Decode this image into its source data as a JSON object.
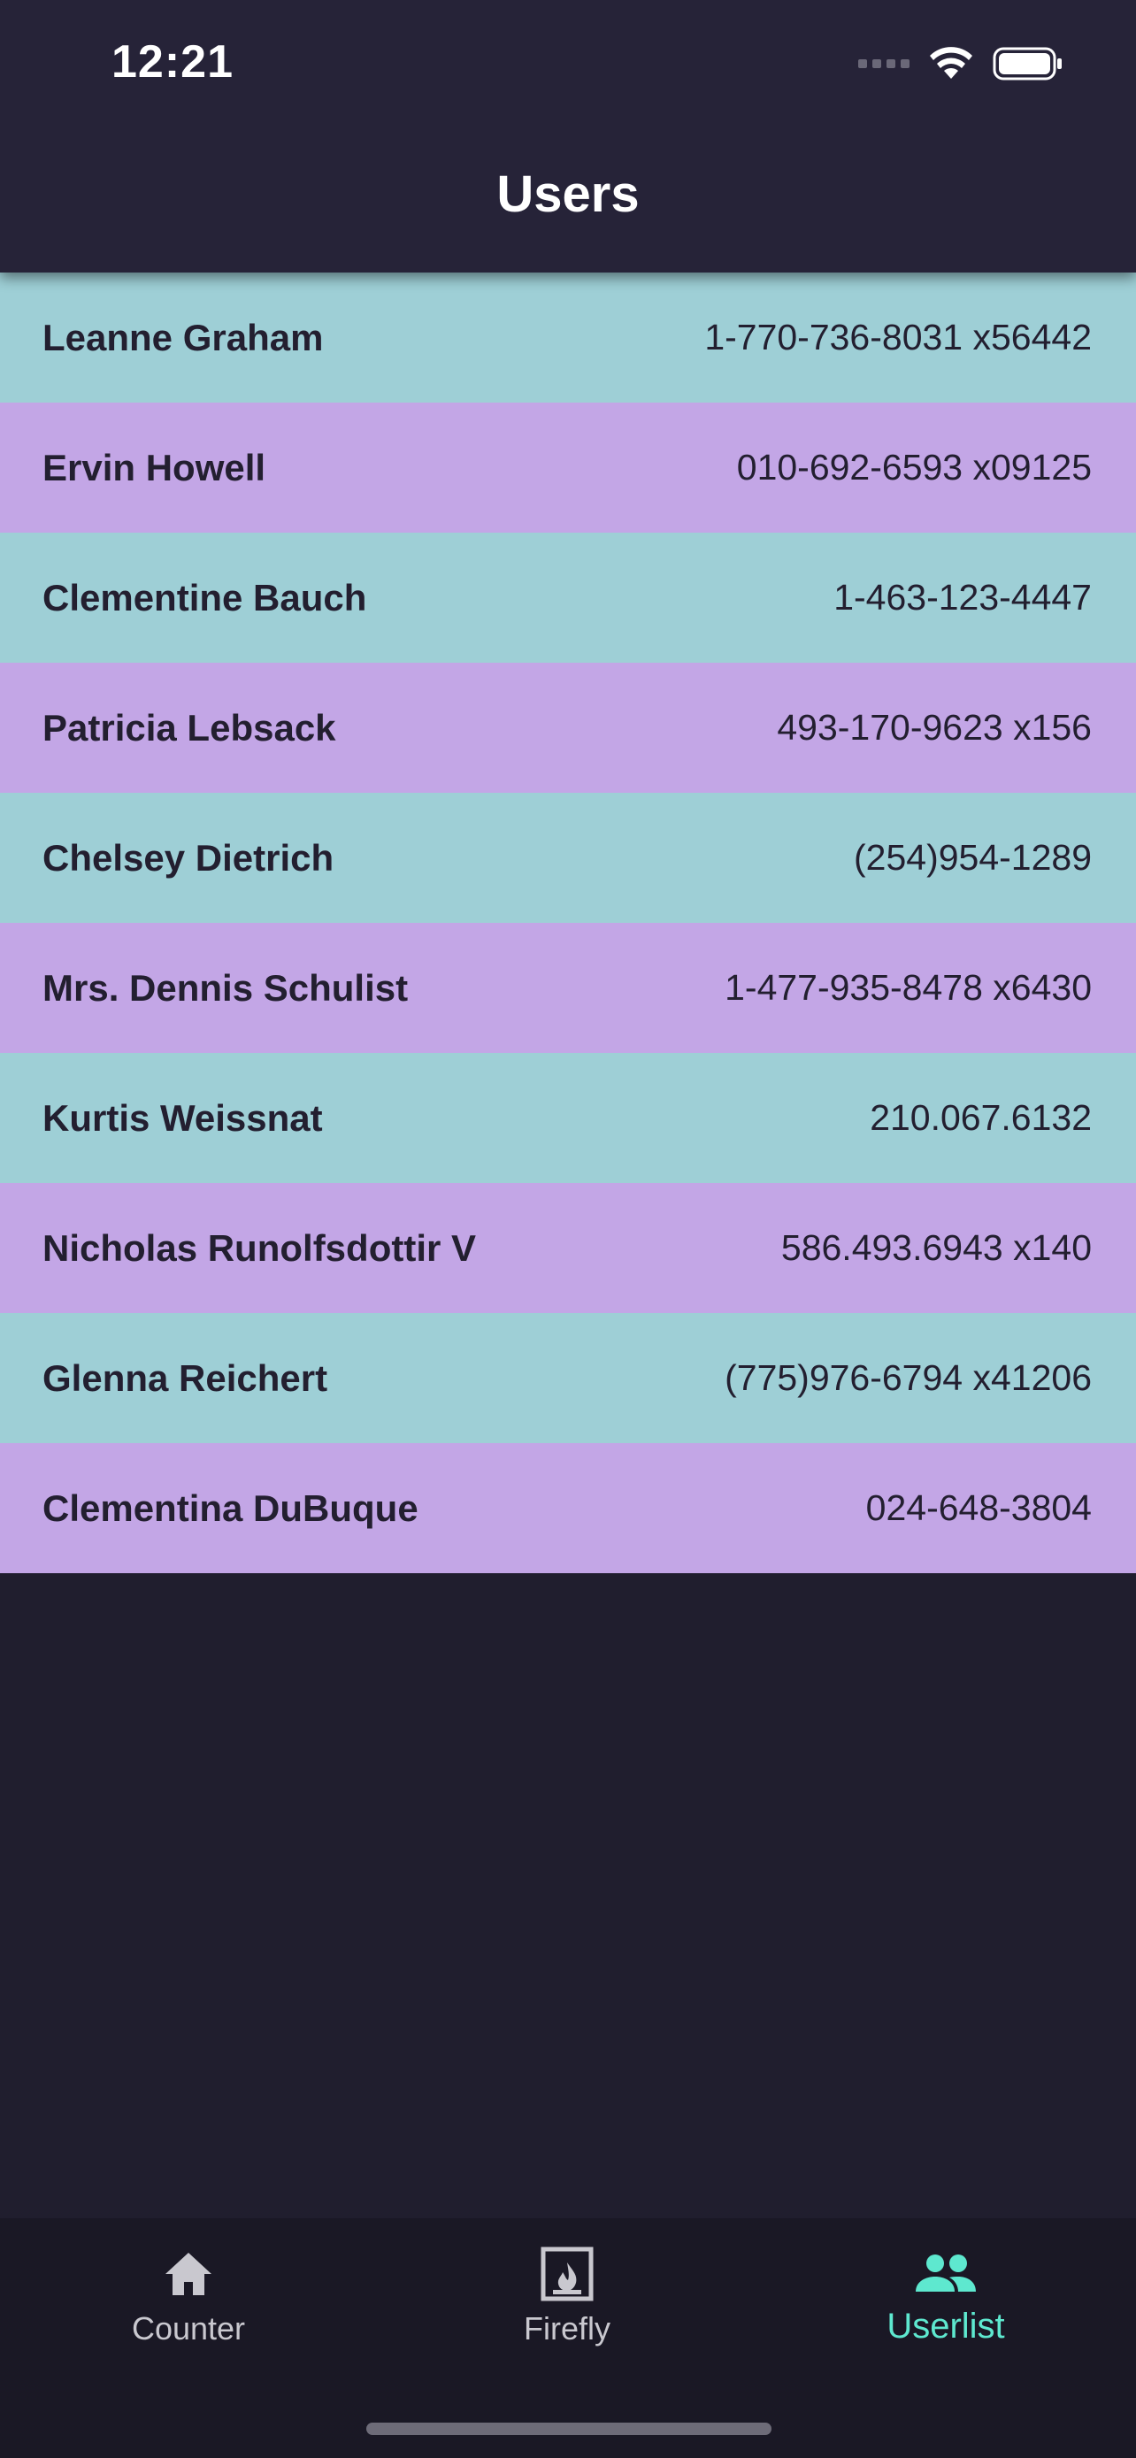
{
  "status_bar": {
    "time": "12:21"
  },
  "header": {
    "title": "Users"
  },
  "users": [
    {
      "name": "Leanne Graham",
      "phone": "1-770-736-8031 x56442"
    },
    {
      "name": "Ervin Howell",
      "phone": "010-692-6593 x09125"
    },
    {
      "name": "Clementine Bauch",
      "phone": "1-463-123-4447"
    },
    {
      "name": "Patricia Lebsack",
      "phone": "493-170-9623 x156"
    },
    {
      "name": "Chelsey Dietrich",
      "phone": "(254)954-1289"
    },
    {
      "name": "Mrs. Dennis Schulist",
      "phone": "1-477-935-8478 x6430"
    },
    {
      "name": "Kurtis Weissnat",
      "phone": "210.067.6132"
    },
    {
      "name": "Nicholas Runolfsdottir V",
      "phone": "586.493.6943 x140"
    },
    {
      "name": "Glenna Reichert",
      "phone": "(775)976-6794 x41206"
    },
    {
      "name": "Clementina DuBuque",
      "phone": "024-648-3804"
    }
  ],
  "tabbar": {
    "tabs": [
      {
        "label": "Counter",
        "icon": "home-icon",
        "active": false
      },
      {
        "label": "Firefly",
        "icon": "fireplace-icon",
        "active": false
      },
      {
        "label": "Userlist",
        "icon": "people-icon",
        "active": true
      }
    ]
  },
  "colors": {
    "background": "#201e2e",
    "header": "#262338",
    "row_even": "#9ecfd6",
    "row_odd": "#c3a6e6",
    "accent": "#5ee8cf",
    "text_dark": "#231f30"
  }
}
